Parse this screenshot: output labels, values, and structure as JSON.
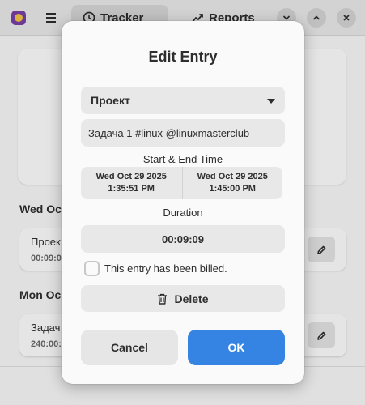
{
  "header": {
    "tabs": [
      {
        "label": "Tracker",
        "icon": "clock-icon"
      },
      {
        "label": "Reports",
        "icon": "chart-icon"
      }
    ]
  },
  "list": {
    "days": [
      {
        "header": "Wed Oc",
        "entry": {
          "name": "Проек",
          "duration": "00:09:0"
        }
      },
      {
        "header": "Mon Oc",
        "entry": {
          "name": "Задач",
          "duration": "240:00:"
        }
      }
    ]
  },
  "dialog": {
    "title": "Edit Entry",
    "project": {
      "value": "Проект"
    },
    "description": {
      "value": "Задача 1 #linux @linuxmasterclub"
    },
    "time_label": "Start & End Time",
    "start": {
      "date": "Wed Oct 29 2025",
      "time": "1:35:51 PM"
    },
    "end": {
      "date": "Wed Oct 29 2025",
      "time": "1:45:00 PM"
    },
    "duration_label": "Duration",
    "duration_value": "00:09:09",
    "billed_label": "This entry has been billed.",
    "billed_checked": false,
    "delete_label": "Delete",
    "cancel_label": "Cancel",
    "ok_label": "OK"
  },
  "colors": {
    "accent": "#3584e4",
    "field_bg": "#e8e8e8",
    "dialog_bg": "#fafafa"
  }
}
